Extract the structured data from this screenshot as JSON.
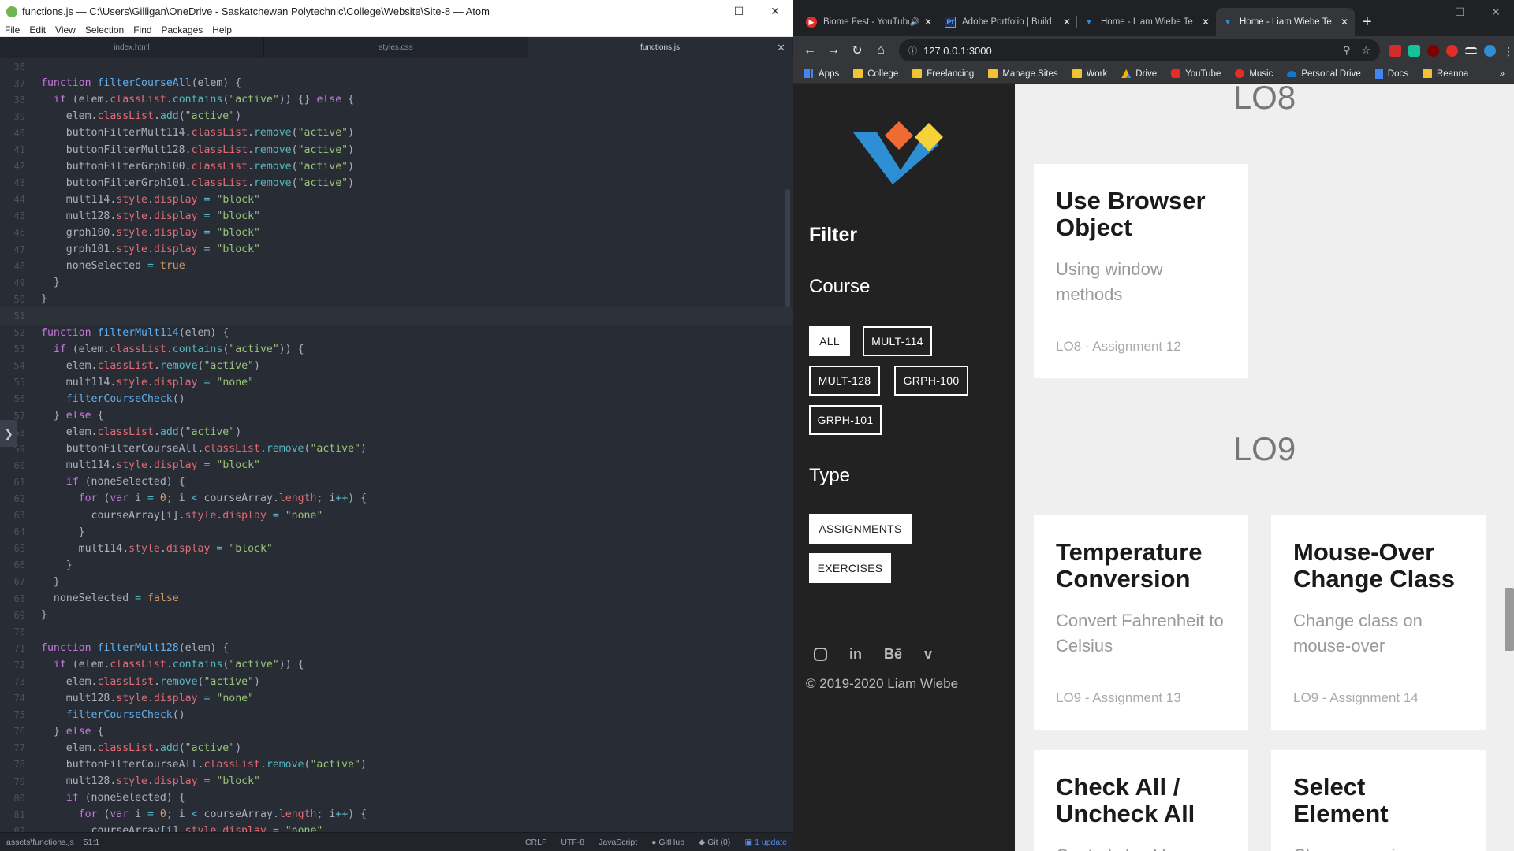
{
  "atom": {
    "title": "functions.js — C:\\Users\\Gilligan\\OneDrive - Saskatchewan Polytechnic\\College\\Website\\Site-8 — Atom",
    "menu": [
      "File",
      "Edit",
      "View",
      "Selection",
      "Find",
      "Packages",
      "Help"
    ],
    "tabs": [
      {
        "label": "index.html",
        "active": false
      },
      {
        "label": "styles.css",
        "active": false
      },
      {
        "label": "functions.js",
        "active": true
      }
    ],
    "status": {
      "path": "assets\\functions.js",
      "cursor": "51:1",
      "line_ending": "CRLF",
      "encoding": "UTF-8",
      "grammar": "JavaScript",
      "github": "GitHub",
      "git": "Git (0)",
      "update": "1 update"
    },
    "line_numbers": [
      "36",
      "37",
      "38",
      "39",
      "40",
      "41",
      "42",
      "43",
      "44",
      "45",
      "46",
      "47",
      "48",
      "49",
      "50",
      "51",
      "52",
      "53",
      "54",
      "55",
      "56",
      "57",
      "58",
      "59",
      "60",
      "61",
      "62",
      "63",
      "64",
      "65",
      "66",
      "67",
      "68",
      "69",
      "70",
      "71",
      "72",
      "73",
      "74",
      "75",
      "76",
      "77",
      "78",
      "79",
      "80",
      "81",
      "82"
    ],
    "code_lines": [
      "",
      "function filterCourseAll(elem) {",
      "  if (elem.classList.contains(\"active\")) {} else {",
      "    elem.classList.add(\"active\")",
      "    buttonFilterMult114.classList.remove(\"active\")",
      "    buttonFilterMult128.classList.remove(\"active\")",
      "    buttonFilterGrph100.classList.remove(\"active\")",
      "    buttonFilterGrph101.classList.remove(\"active\")",
      "    mult114.style.display = \"block\"",
      "    mult128.style.display = \"block\"",
      "    grph100.style.display = \"block\"",
      "    grph101.style.display = \"block\"",
      "    noneSelected = true",
      "  }",
      "}",
      "",
      "function filterMult114(elem) {",
      "  if (elem.classList.contains(\"active\")) {",
      "    elem.classList.remove(\"active\")",
      "    mult114.style.display = \"none\"",
      "    filterCourseCheck()",
      "  } else {",
      "    elem.classList.add(\"active\")",
      "    buttonFilterCourseAll.classList.remove(\"active\")",
      "    mult114.style.display = \"block\"",
      "    if (noneSelected) {",
      "      for (var i = 0; i < courseArray.length; i++) {",
      "        courseArray[i].style.display = \"none\"",
      "      }",
      "      mult114.style.display = \"block\"",
      "    }",
      "  }",
      "  noneSelected = false",
      "}",
      "",
      "function filterMult128(elem) {",
      "  if (elem.classList.contains(\"active\")) {",
      "    elem.classList.remove(\"active\")",
      "    mult128.style.display = \"none\"",
      "    filterCourseCheck()",
      "  } else {",
      "    elem.classList.add(\"active\")",
      "    buttonFilterCourseAll.classList.remove(\"active\")",
      "    mult128.style.display = \"block\"",
      "    if (noneSelected) {",
      "      for (var i = 0; i < courseArray.length; i++) {",
      "        courseArray[i].style.display = \"none\""
    ]
  },
  "chrome": {
    "tabs": [
      {
        "label": "Biome Fest - YouTube",
        "active": false,
        "favicon": "youtube-icon"
      },
      {
        "label": "Adobe Portfolio | Build",
        "active": false,
        "favicon": "adobe-portfolio-icon"
      },
      {
        "label": "Home - Liam Wiebe Te",
        "active": false,
        "favicon": "site-logo-icon"
      },
      {
        "label": "Home - Liam Wiebe Te",
        "active": true,
        "favicon": "site-logo-icon"
      }
    ],
    "url": "127.0.0.1:3000",
    "bookmarks": [
      {
        "label": "Apps",
        "icon": "apps-icon"
      },
      {
        "label": "College",
        "icon": "folder-icon"
      },
      {
        "label": "Freelancing",
        "icon": "folder-icon"
      },
      {
        "label": "Manage Sites",
        "icon": "folder-icon"
      },
      {
        "label": "Work",
        "icon": "folder-icon"
      },
      {
        "label": "Drive",
        "icon": "drive-icon"
      },
      {
        "label": "YouTube",
        "icon": "youtube-icon"
      },
      {
        "label": "Music",
        "icon": "music-icon"
      },
      {
        "label": "Personal Drive",
        "icon": "onedrive-icon"
      },
      {
        "label": "Docs",
        "icon": "docs-icon"
      },
      {
        "label": "Reanna",
        "icon": "folder-icon"
      }
    ]
  },
  "site": {
    "filter_heading": "Filter",
    "course_heading": "Course",
    "course_buttons": [
      "ALL",
      "MULT-114",
      "MULT-128",
      "GRPH-100",
      "GRPH-101"
    ],
    "type_heading": "Type",
    "type_buttons": [
      "ASSIGNMENTS",
      "EXERCISES"
    ],
    "socials": [
      "instagram-icon",
      "linkedin-icon",
      "behance-icon",
      "vimeo-icon"
    ],
    "copyright": "© 2019-2020 Liam Wiebe",
    "sections": [
      {
        "heading": "LO8"
      },
      {
        "heading": "LO9"
      }
    ],
    "cards": [
      {
        "title": "Use Browser Object",
        "desc": "Using window methods",
        "assign": "LO8 - Assignment 12"
      },
      {
        "title": "Temperature Conversion",
        "desc": "Convert Fahrenheit to Celsius",
        "assign": "LO9 - Assignment 13"
      },
      {
        "title": "Mouse-Over Change Class",
        "desc": "Change class on mouse-over",
        "assign": "LO9 - Assignment 14"
      },
      {
        "title": "Check All / Uncheck All",
        "desc": "Control checkboxes",
        "assign": ""
      },
      {
        "title": "Select Element",
        "desc": "Choose province",
        "assign": ""
      }
    ]
  }
}
